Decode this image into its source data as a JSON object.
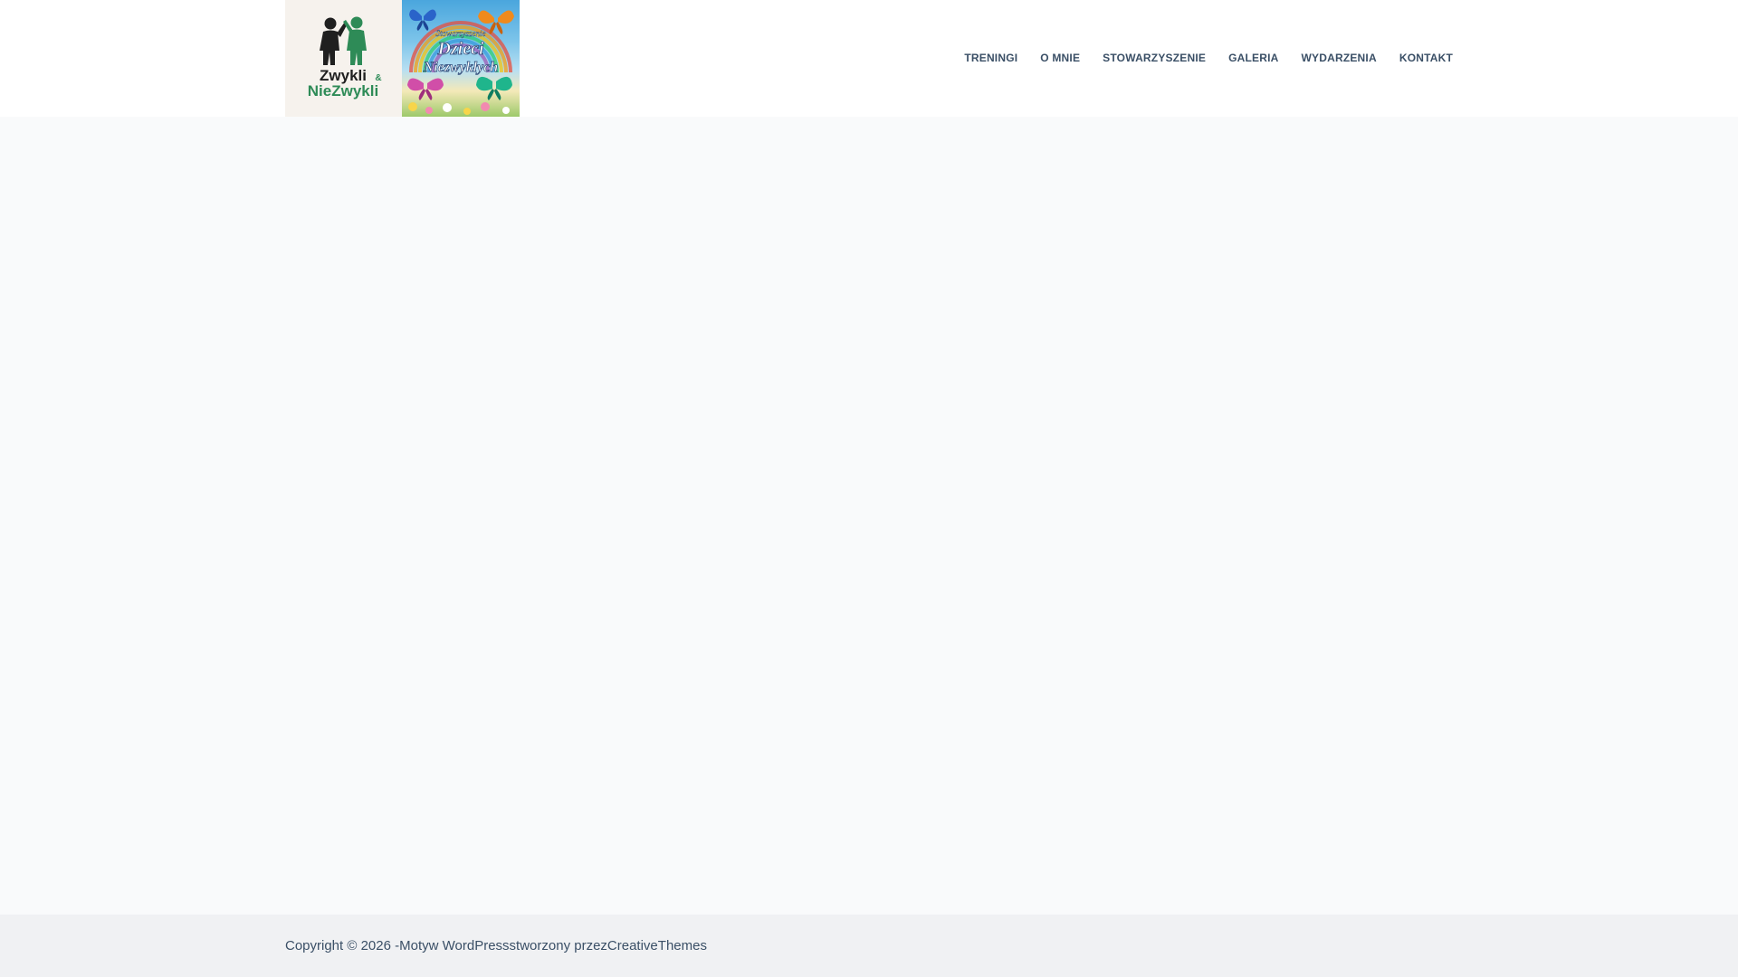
{
  "header": {
    "logo_left": {
      "line1": "Zwykli",
      "ampersand": "&",
      "line2": "NieZwykli"
    },
    "logo_right": {
      "line1": "Stowarzyszenie",
      "line2": "Dzieci",
      "line3": "Niezwykłych"
    }
  },
  "nav": {
    "items": [
      {
        "label": "TRENINGI"
      },
      {
        "label": "O MNIE"
      },
      {
        "label": "STOWARZYSZENIE"
      },
      {
        "label": "GALERIA"
      },
      {
        "label": "WYDARZENIA"
      },
      {
        "label": "KONTAKT"
      }
    ]
  },
  "footer": {
    "copyright_prefix": "Copyright © 2026 - ",
    "theme_text": "Motyw WordPress",
    "created_by": " stworzony przez ",
    "author": "CreativeThemes"
  },
  "colors": {
    "text": "#3a4f66",
    "header_bg": "#ffffff",
    "page_bg": "#f9fafb",
    "footer_bg": "#f0f1f3",
    "logo_dark": "#1f1f1f",
    "logo_green": "#2e8b57"
  }
}
